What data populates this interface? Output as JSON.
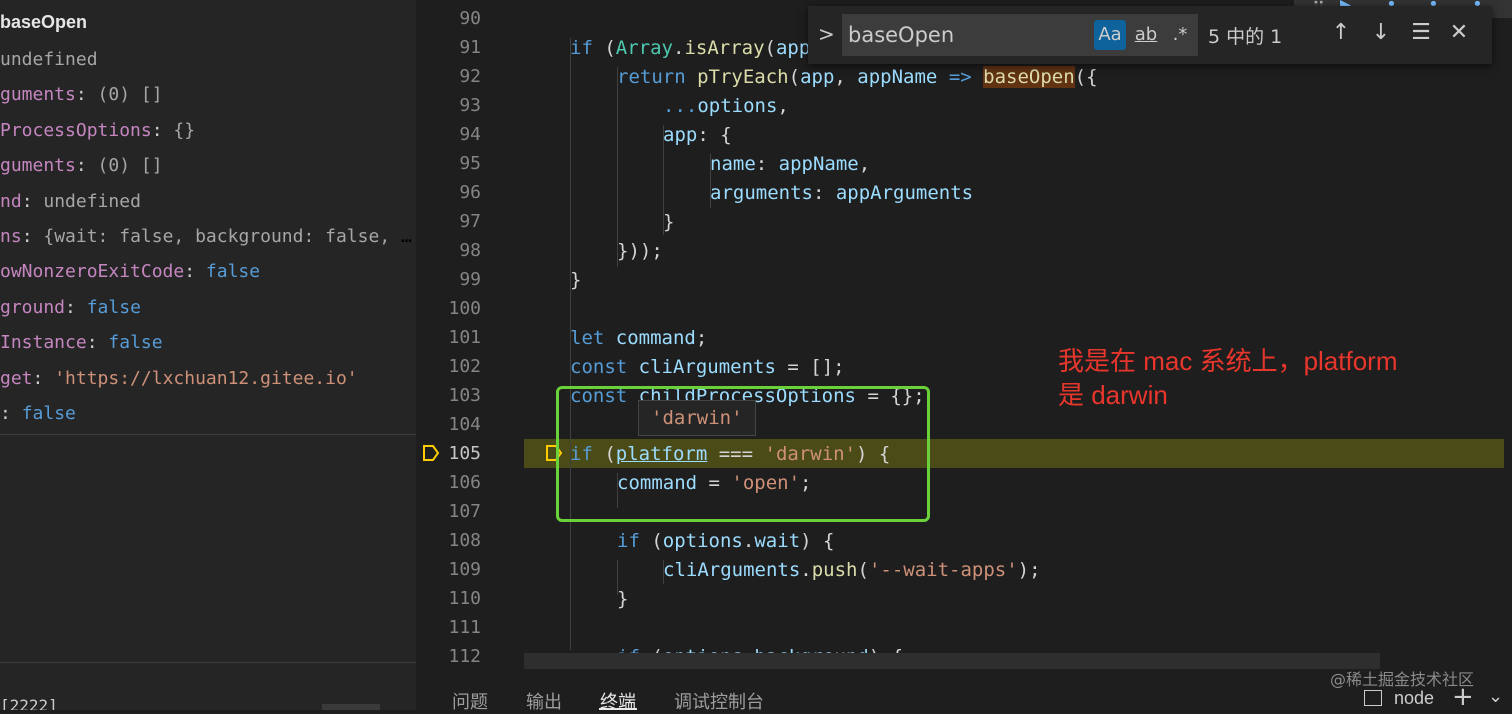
{
  "variables": {
    "title": "baseOpen",
    "rows": [
      {
        "key": "",
        "sep": "",
        "value": "undefined",
        "kind": "plain"
      },
      {
        "key": "guments",
        "sep": ": ",
        "value": "(0) []",
        "kind": "plain"
      },
      {
        "key": "ProcessOptions",
        "sep": ": ",
        "value": "{}",
        "kind": "plain"
      },
      {
        "key": "guments",
        "sep": ": ",
        "value": "(0) []",
        "kind": "plain"
      },
      {
        "key": "nd",
        "sep": ": ",
        "value": "undefined",
        "kind": "plain"
      },
      {
        "key": "ns",
        "sep": ": ",
        "value": "{wait: false, background: false, n…",
        "kind": "plain"
      },
      {
        "key": "owNonzeroExitCode",
        "sep": ": ",
        "value": "false",
        "kind": "bool"
      },
      {
        "key": "ground",
        "sep": ": ",
        "value": "false",
        "kind": "bool"
      },
      {
        "key": "Instance",
        "sep": ": ",
        "value": "false",
        "kind": "bool"
      },
      {
        "key": "get",
        "sep": ": ",
        "value": "'https://lxchuan12.gitee.io'",
        "kind": "str"
      },
      {
        "key": "",
        "sep": ": ",
        "value": "false",
        "kind": "bool"
      }
    ],
    "bottom_text": "                   [2222]"
  },
  "editor": {
    "line_numbers": [
      "90",
      "91",
      "92",
      "93",
      "94",
      "95",
      "96",
      "97",
      "98",
      "99",
      "100",
      "101",
      "102",
      "103",
      "104",
      "105",
      "106",
      "107",
      "108",
      "109",
      "110",
      "111",
      "112"
    ],
    "current_line": "105",
    "hover_value": "'darwin'"
  },
  "find": {
    "query": "baseOpen",
    "match_case": "Aa",
    "whole_word": "ab",
    "regex": ".*",
    "count": "5 中的 1"
  },
  "annotation": {
    "line1": "我是在 mac 系统上，platform",
    "line2": "是 darwin"
  },
  "panel_tabs": {
    "problems": "问题",
    "output": "输出",
    "terminal": "终端",
    "debug_console": "调试控制台",
    "terminal_name": "node"
  },
  "watermark": "@稀土掘金技术社区",
  "colors": {
    "keyword": "#569cd6",
    "string": "#ce9178",
    "function": "#dcdcaa",
    "highlight_line": "#4b4b18",
    "annotation_box": "#6ad13a",
    "annotation_text": "#e8362c"
  }
}
